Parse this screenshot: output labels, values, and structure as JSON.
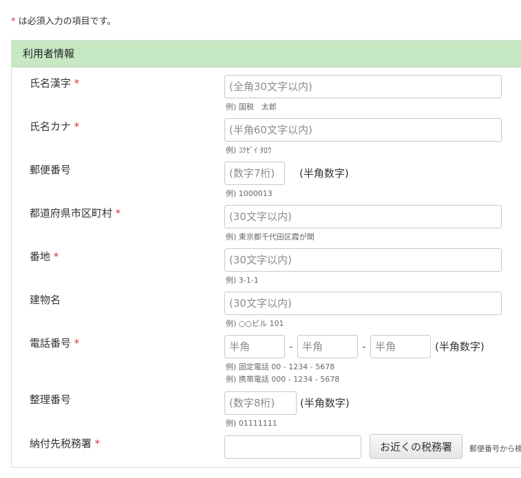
{
  "notice": {
    "asterisk": "*",
    "text": " は必須入力の項目です。"
  },
  "section": {
    "title": "利用者情報"
  },
  "fields": {
    "name_kanji": {
      "label": "氏名漢字",
      "required": "*",
      "placeholder": "(全角30文字以内)",
      "example": "例) 国税　太郎"
    },
    "name_kana": {
      "label": "氏名カナ",
      "required": "*",
      "placeholder": "(半角60文字以内)",
      "example": "例) ｺｸｾﾞｲ ﾀﾛｳ"
    },
    "postal_code": {
      "label": "郵便番号",
      "placeholder": "(数字7桁)",
      "suffix": "(半角数字)",
      "example": "例) 1000013"
    },
    "prefecture_city": {
      "label": "都道府県市区町村",
      "required": "*",
      "placeholder": "(30文字以内)",
      "example": "例) 東京都千代田区霞が関"
    },
    "street": {
      "label": "番地",
      "required": "*",
      "placeholder": "(30文字以内)",
      "example": "例) 3-1-1"
    },
    "building": {
      "label": "建物名",
      "placeholder": "(30文字以内)",
      "example": "例) ○○ビル 101"
    },
    "phone": {
      "label": "電話番号",
      "required": "*",
      "placeholder1": "半角",
      "placeholder2": "半角",
      "placeholder3": "半角",
      "separator": "-",
      "suffix": "(半角数字)",
      "example1": "例) 固定電話 00 - 1234 - 5678",
      "example2": "例) 携帯電話 000 - 1234 - 5678"
    },
    "reference_number": {
      "label": "整理番号",
      "placeholder": "(数字8桁)",
      "suffix": "(半角数字)",
      "example": "例) 01111111"
    },
    "tax_office": {
      "label": "納付先税務署",
      "required": "*",
      "button": "お近くの税務署",
      "aside": "郵便番号から検"
    }
  }
}
